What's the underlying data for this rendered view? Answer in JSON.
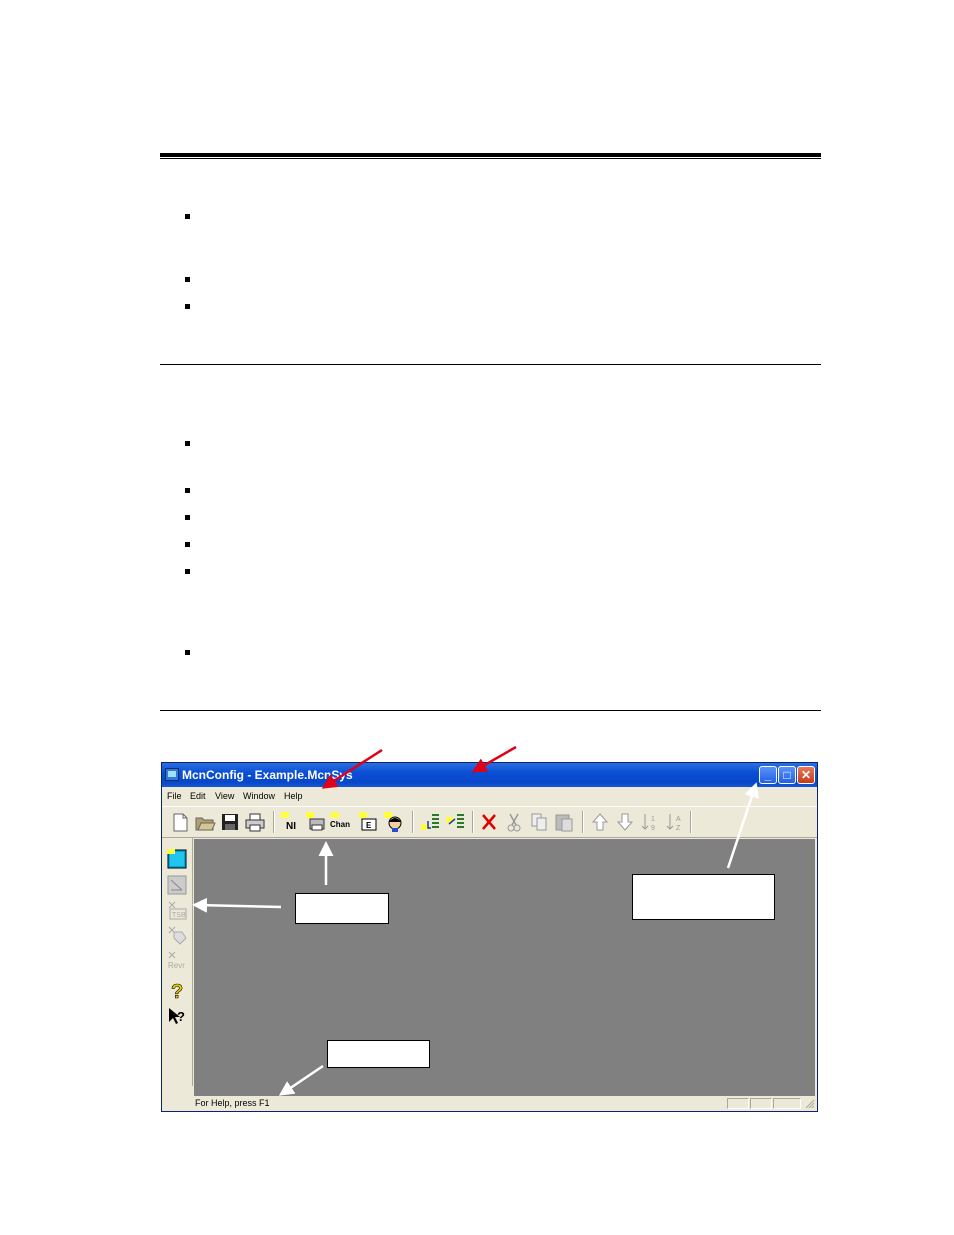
{
  "window": {
    "title": "McnConfig - Example.McnSys",
    "controls": {
      "minimize": "_",
      "maximize": "□",
      "close": "✕"
    }
  },
  "menu": [
    "File",
    "Edit",
    "View",
    "Window",
    "Help"
  ],
  "toolbar": {
    "ni_label": "NI",
    "chan_label": "Chan",
    "e_label": "E"
  },
  "lefttools": {
    "tsb_label": "TSB",
    "revr_label": "Revr"
  },
  "status": {
    "text": "For Help, press F1"
  },
  "colors": {
    "titlebar": "#0a4fd6",
    "workspace": "#808080",
    "chrome": "#ece9d8",
    "annotation_red": "#e0001a",
    "annotation_white": "#ffffff"
  }
}
